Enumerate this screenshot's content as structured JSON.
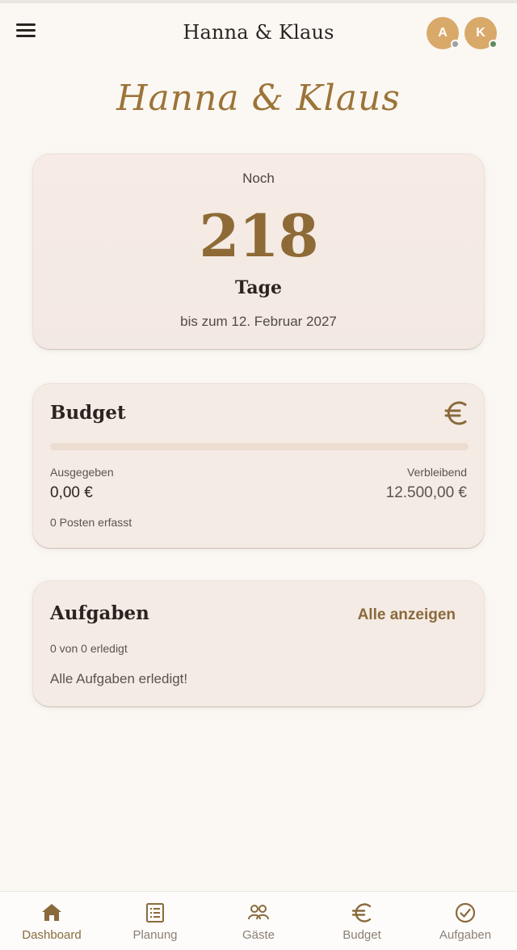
{
  "header": {
    "title": "Hanna & Klaus",
    "avatars": [
      {
        "initial": "A",
        "status_color": "#9aa0a6"
      },
      {
        "initial": "K",
        "status_color": "#5f8a5f"
      }
    ]
  },
  "hero": {
    "script_title": "Hanna & Klaus"
  },
  "countdown": {
    "prefix": "Noch",
    "days": "218",
    "unit": "Tage",
    "date_text": "bis zum 12. Februar 2027"
  },
  "budget": {
    "title": "Budget",
    "icon": "euro-icon",
    "progress_fraction": 0,
    "spent_label": "Ausgegeben",
    "spent_value": "0,00 €",
    "remaining_label": "Verbleibend",
    "remaining_value": "12.500,00 €",
    "items_text": "0 Posten erfasst"
  },
  "tasks": {
    "title": "Aufgaben",
    "show_all_label": "Alle anzeigen",
    "count_text": "0 von 0 erledigt",
    "empty_text": "Alle Aufgaben erledigt!"
  },
  "bottom_nav": [
    {
      "label": "Dashboard",
      "icon": "home-icon",
      "active": true
    },
    {
      "label": "Planung",
      "icon": "list-icon",
      "active": false
    },
    {
      "label": "Gäste",
      "icon": "guests-icon",
      "active": false
    },
    {
      "label": "Budget",
      "icon": "euro-icon",
      "active": false
    },
    {
      "label": "Aufgaben",
      "icon": "check-circle-icon",
      "active": false
    }
  ],
  "colors": {
    "accent": "#8a6a3c",
    "script_gold": "#9c7438",
    "avatar_bg": "#d9a96a",
    "card_bg": "#f5ebe5",
    "page_bg": "#fbf8f4"
  }
}
